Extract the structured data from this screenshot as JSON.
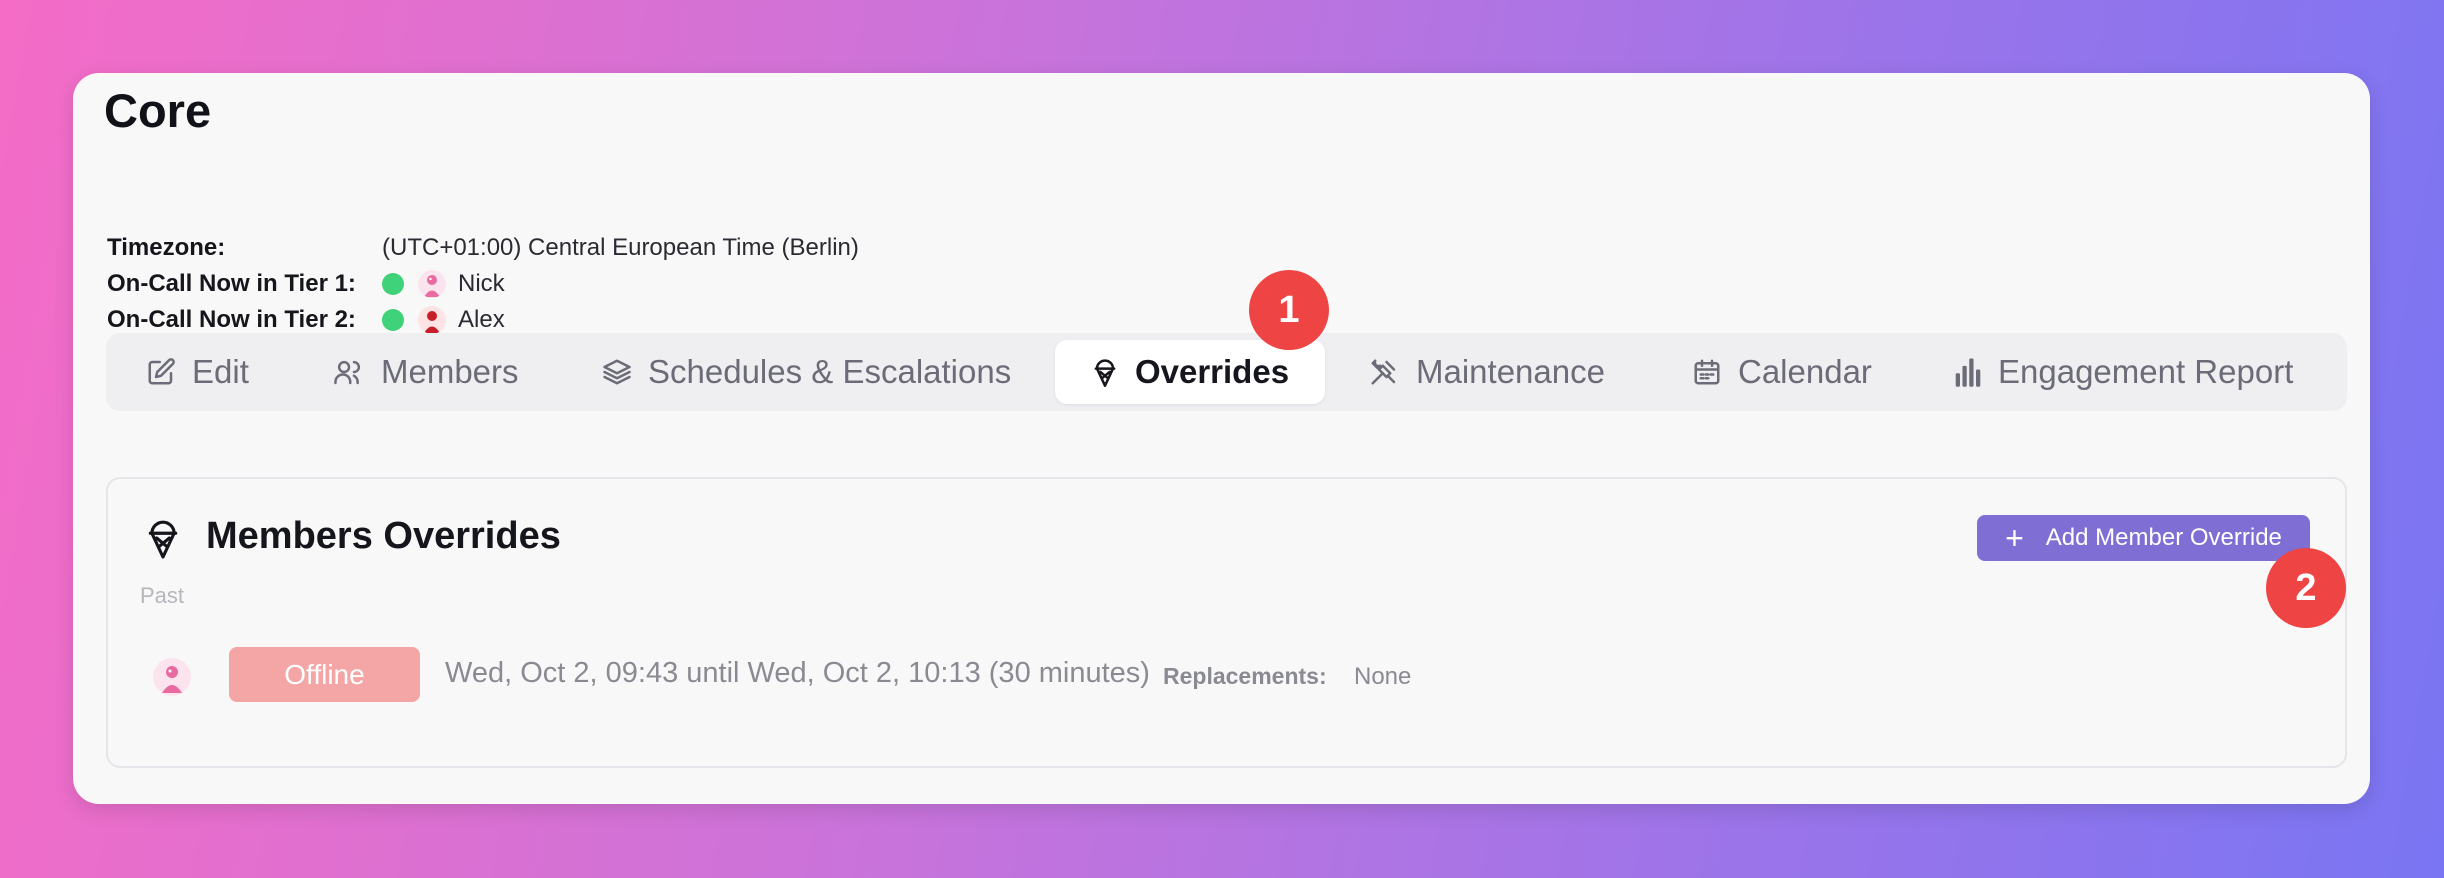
{
  "page": {
    "title": "Core"
  },
  "info": {
    "timezone_label": "Timezone:",
    "timezone_value": "(UTC+01:00) Central European Time (Berlin)",
    "tier1_label": "On-Call Now in Tier 1:",
    "tier1_name": "Nick",
    "tier2_label": "On-Call Now in Tier 2:",
    "tier2_name": "Alex",
    "status_color": "#3fd27a"
  },
  "tabs": [
    {
      "label": "Edit",
      "icon": "edit-icon"
    },
    {
      "label": "Members",
      "icon": "users-icon"
    },
    {
      "label": "Schedules & Escalations",
      "icon": "layers-icon"
    },
    {
      "label": "Overrides",
      "icon": "ice-cream-icon",
      "active": true
    },
    {
      "label": "Maintenance",
      "icon": "tools-icon"
    },
    {
      "label": "Calendar",
      "icon": "calendar-icon"
    },
    {
      "label": "Engagement Report",
      "icon": "bar-chart-icon"
    }
  ],
  "badges": {
    "first": "1",
    "second": "2",
    "color": "#ee4444"
  },
  "overrides": {
    "title": "Members Overrides",
    "section_label": "Past",
    "add_button_label": "Add Member Override",
    "add_button_color": "#7f6ed4",
    "entries": [
      {
        "status": "Offline",
        "time_range": "Wed, Oct 2, 09:43 until Wed, Oct 2, 10:13 (30 minutes)",
        "replacements_label": "Replacements:",
        "replacements_value": "None"
      }
    ]
  }
}
